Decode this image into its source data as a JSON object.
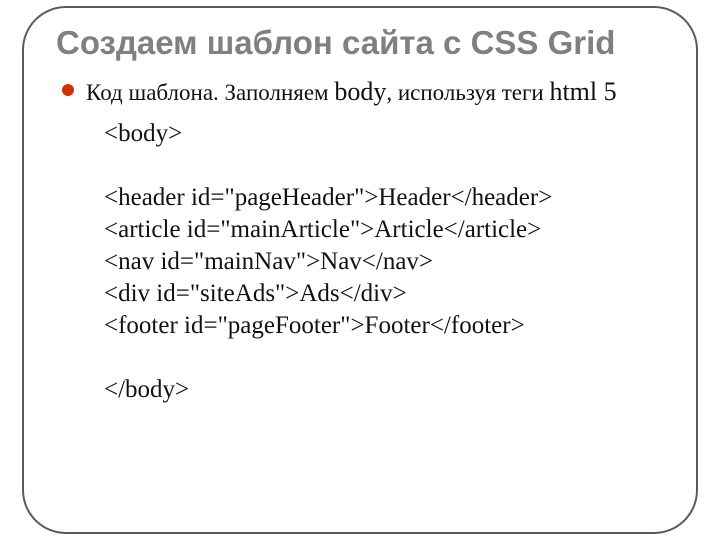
{
  "title": "Создаем шаблон сайта с CSS Grid",
  "subtitle": {
    "part1": "Код шаблона. Заполняем ",
    "body_word": "body",
    "part2": ", используя теги ",
    "html5": "html 5"
  },
  "code": {
    "l1": "<body>",
    "blank": "",
    "l2": "<header id=\"pageHeader\">Header</header>",
    "l3": "<article id=\"mainArticle\">Article</article>",
    "l4": "<nav id=\"mainNav\">Nav</nav>",
    "l5": "<div id=\"siteAds\">Ads</div>",
    "l6": "<footer id=\"pageFooter\">Footer</footer>",
    "l7": "</body>"
  }
}
